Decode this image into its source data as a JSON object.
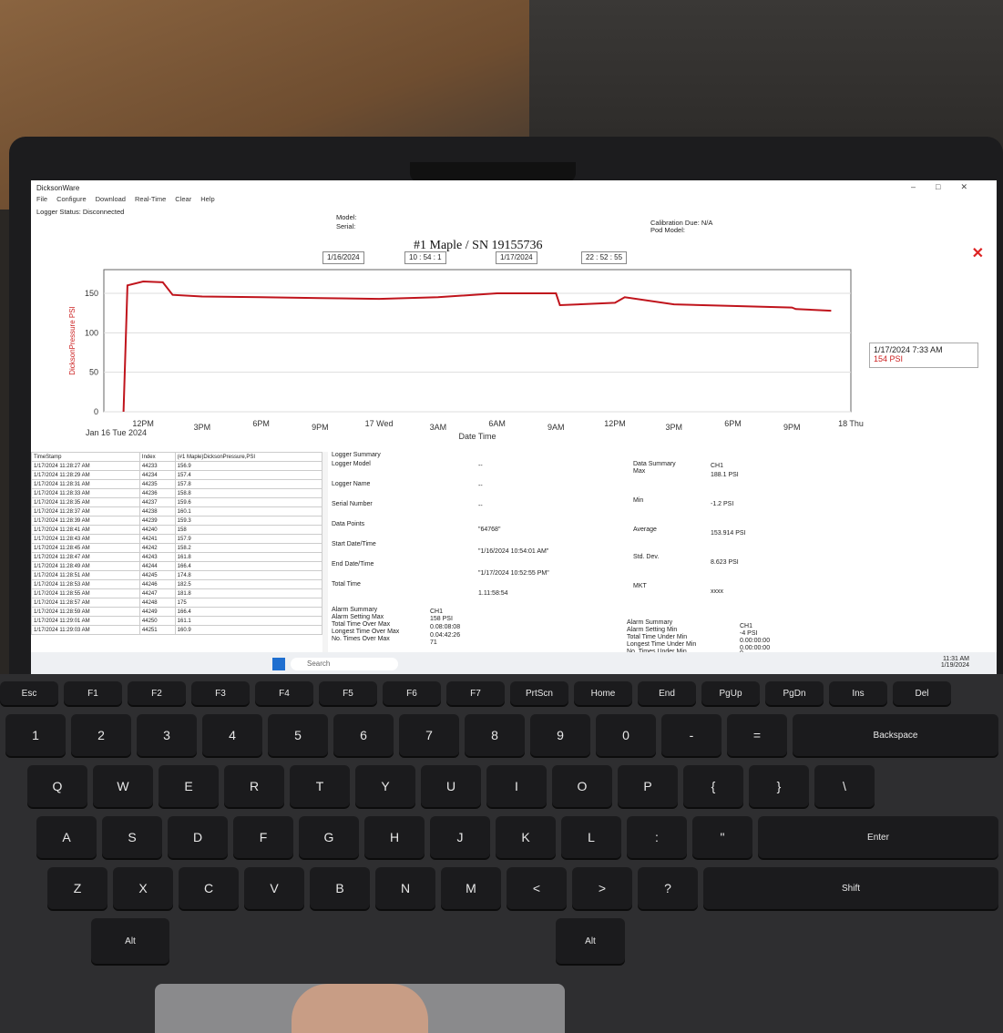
{
  "app": {
    "title": "DicksonWare",
    "menu": [
      "File",
      "Configure",
      "Download",
      "Real-Time",
      "Clear",
      "Help"
    ],
    "logger_status": "Logger Status: Disconnected",
    "model_label": "Model:",
    "serial_label": "Serial:",
    "calibration_due": "Calibration Due: N/A",
    "pod_model": "Pod Model:"
  },
  "chart_window": {
    "title": "#1 Maple / SN 19155736",
    "start_date": "1/16/2024",
    "start_time": "10 : 54 : 1",
    "end_date": "1/17/2024",
    "end_time": "22 : 52 : 55",
    "tooltip_time": "1/17/2024 7:33 AM",
    "tooltip_value": "154 PSI",
    "line_color": "#c0141c"
  },
  "chart_data": {
    "type": "line",
    "ylabel": "DicksonPressure PSI",
    "xlabel": "Date Time",
    "ylim": [
      0,
      180
    ],
    "yticks": [
      0,
      50,
      100,
      150
    ],
    "xtick_labels": [
      "12PM",
      "3PM",
      "6PM",
      "9PM",
      "17 Wed",
      "3AM",
      "6AM",
      "9AM",
      "12PM",
      "3PM",
      "6PM",
      "9PM",
      "18 Thu"
    ],
    "start_label": "Jan 16 Tue 2024",
    "series": [
      {
        "x": [
          11,
          11.2,
          12,
          13,
          13.5,
          15,
          18,
          21,
          24,
          27,
          30,
          33,
          33.2,
          36,
          36.5,
          39,
          42,
          45,
          45.2,
          47
        ],
        "y": [
          0,
          160,
          165,
          164,
          148,
          146,
          145,
          144,
          143,
          145,
          150,
          150,
          135,
          138,
          145,
          136,
          134,
          132,
          130,
          128
        ]
      }
    ]
  },
  "table": {
    "headers": [
      "TimeStamp",
      "Index",
      "(#1 Maple)DicksonPressure,PSI"
    ],
    "rows": [
      [
        "1/17/2024 11:28:27 AM",
        "44233",
        "156.9"
      ],
      [
        "1/17/2024 11:28:29 AM",
        "44234",
        "157.4"
      ],
      [
        "1/17/2024 11:28:31 AM",
        "44235",
        "157.8"
      ],
      [
        "1/17/2024 11:28:33 AM",
        "44236",
        "158.8"
      ],
      [
        "1/17/2024 11:28:35 AM",
        "44237",
        "159.6"
      ],
      [
        "1/17/2024 11:28:37 AM",
        "44238",
        "160.1"
      ],
      [
        "1/17/2024 11:28:39 AM",
        "44239",
        "159.3"
      ],
      [
        "1/17/2024 11:28:41 AM",
        "44240",
        "158"
      ],
      [
        "1/17/2024 11:28:43 AM",
        "44241",
        "157.9"
      ],
      [
        "1/17/2024 11:28:45 AM",
        "44242",
        "158.2"
      ],
      [
        "1/17/2024 11:28:47 AM",
        "44243",
        "161.8"
      ],
      [
        "1/17/2024 11:28:49 AM",
        "44244",
        "166.4"
      ],
      [
        "1/17/2024 11:28:51 AM",
        "44245",
        "174.8"
      ],
      [
        "1/17/2024 11:28:53 AM",
        "44246",
        "182.5"
      ],
      [
        "1/17/2024 11:28:55 AM",
        "44247",
        "181.8"
      ],
      [
        "1/17/2024 11:28:57 AM",
        "44248",
        "175"
      ],
      [
        "1/17/2024 11:28:59 AM",
        "44249",
        "166.4"
      ],
      [
        "1/17/2024 11:29:01 AM",
        "44250",
        "161.1"
      ],
      [
        "1/17/2024 11:29:03 AM",
        "44251",
        "160.9"
      ]
    ]
  },
  "summary": {
    "logger_summary": "Logger Summary",
    "logger_model": "Logger Model",
    "logger_name": "Logger Name",
    "serial_number": "Serial Number",
    "data_points": "Data Points",
    "data_points_val": "\"64768\"",
    "start_dt": "Start Date/Time",
    "start_dt_val": "\"1/16/2024 10:54:01 AM\"",
    "end_dt": "End Date/Time",
    "end_dt_val": "\"1/17/2024 10:52:55 PM\"",
    "total_time": "Total Time",
    "total_time_val": "1.11:58:54",
    "dash": "--",
    "data_summary": "Data Summary",
    "ch1": "CH1",
    "max": "Max",
    "max_val": "188.1 PSI",
    "min": "Min",
    "min_val": "-1.2 PSI",
    "average": "Average",
    "average_val": "153.914 PSI",
    "std_dev": "Std. Dev.",
    "std_dev_val": "8.623 PSI",
    "mkt": "MKT",
    "mkt_val": "xxxx",
    "alarm_summary": "Alarm Summary",
    "alarm_max": "Alarm Setting Max",
    "alarm_max_val": "158 PSI",
    "over_max": "Total Time Over Max",
    "over_max_val": "0.08:08:08",
    "longest_over": "Longest Time Over Max",
    "longest_over_val": "0.04:42:26",
    "times_over": "No. Times Over Max",
    "times_over_val": "71",
    "alarm_min": "Alarm Setting Min",
    "alarm_min_val": "-4 PSI",
    "under_min": "Total Time Under Min",
    "under_min_val": "0.00:00:00",
    "longest_under": "Longest Time Under Min",
    "longest_under_val": "0.00:00:00",
    "times_under": "No. Times Under Min",
    "times_under_val": "0"
  },
  "taskbar": {
    "search": "Search",
    "time": "11:31 AM",
    "date": "1/19/2024"
  },
  "keyboard": {
    "row1": [
      "Esc",
      "F1",
      "F2",
      "F3",
      "F4",
      "F5",
      "F6",
      "F7",
      "PrtScn",
      "Home",
      "End",
      "PgUp",
      "PgDn",
      "Ins",
      "Del"
    ],
    "row2": [
      "1",
      "2",
      "3",
      "4",
      "5",
      "6",
      "7",
      "8",
      "9",
      "0",
      "-",
      "=",
      "Backspace"
    ],
    "row3": [
      "Q",
      "W",
      "E",
      "R",
      "T",
      "Y",
      "U",
      "I",
      "O",
      "P",
      "{",
      "}",
      "\\"
    ],
    "row4": [
      "A",
      "S",
      "D",
      "F",
      "G",
      "H",
      "J",
      "K",
      "L",
      ":",
      "\"",
      "Enter"
    ],
    "row5": [
      "Z",
      "X",
      "C",
      "V",
      "B",
      "N",
      "M",
      "<",
      ">",
      "?",
      "Shift"
    ],
    "row6": [
      "Alt",
      "Alt"
    ]
  }
}
